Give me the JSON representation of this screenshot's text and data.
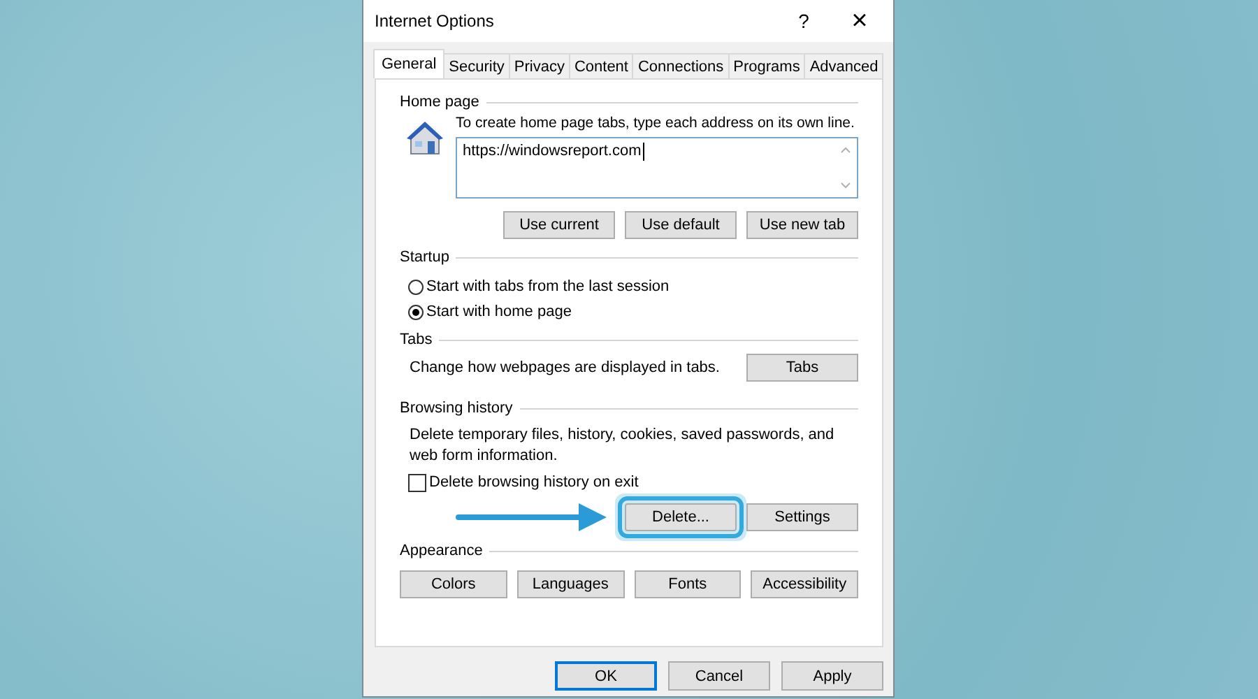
{
  "window": {
    "title": "Internet Options",
    "help": "?",
    "close": "×"
  },
  "tabs": [
    {
      "label": "General",
      "selected": true
    },
    {
      "label": "Security",
      "selected": false
    },
    {
      "label": "Privacy",
      "selected": false
    },
    {
      "label": "Content",
      "selected": false
    },
    {
      "label": "Connections",
      "selected": false
    },
    {
      "label": "Programs",
      "selected": false
    },
    {
      "label": "Advanced",
      "selected": false
    }
  ],
  "home_page": {
    "heading": "Home page",
    "description": "To create home page tabs, type each address on its own line.",
    "value": "https://windowsreport.com",
    "buttons": [
      "Use current",
      "Use default",
      "Use new tab"
    ]
  },
  "startup": {
    "heading": "Startup",
    "options": [
      {
        "label": "Start with tabs from the last session",
        "selected": false
      },
      {
        "label": "Start with home page",
        "selected": true
      }
    ]
  },
  "tabs_section": {
    "heading": "Tabs",
    "description": "Change how webpages are displayed in tabs.",
    "button": "Tabs"
  },
  "browsing_history": {
    "heading": "Browsing history",
    "description": "Delete temporary files, history, cookies, saved passwords, and web form information.",
    "checkbox": {
      "label": "Delete browsing history on exit",
      "checked": false
    },
    "buttons": [
      {
        "label": "Delete...",
        "highlighted": true
      },
      {
        "label": "Settings",
        "highlighted": false
      }
    ]
  },
  "appearance": {
    "heading": "Appearance",
    "buttons": [
      "Colors",
      "Languages",
      "Fonts",
      "Accessibility"
    ]
  },
  "footer_buttons": [
    {
      "label": "OK",
      "default": true
    },
    {
      "label": "Cancel",
      "default": false
    },
    {
      "label": "Apply",
      "default": false
    }
  ]
}
